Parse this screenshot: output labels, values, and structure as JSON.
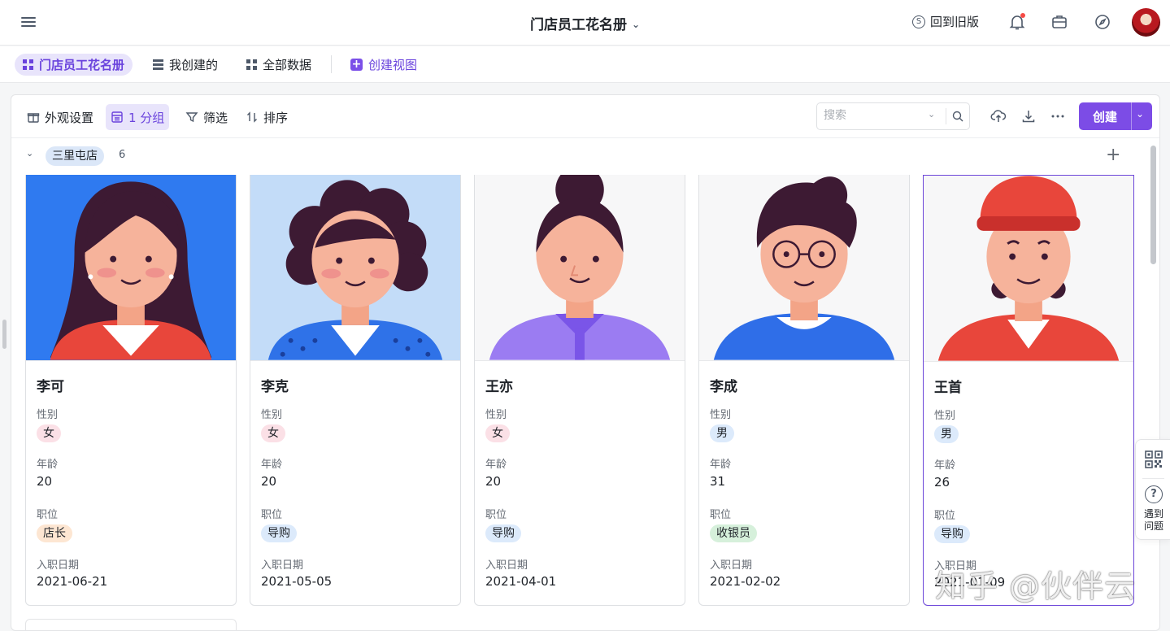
{
  "app": {
    "title": "门店员工花名册",
    "back_old_label": "回到旧版"
  },
  "header_icons": [
    "menu-icon",
    "bell-icon",
    "briefcase-icon",
    "compass-icon"
  ],
  "tabs": [
    {
      "label": "门店员工花名册",
      "active": true
    },
    {
      "label": "我创建的",
      "active": false
    },
    {
      "label": "全部数据",
      "active": false
    },
    {
      "label": "创建视图",
      "active": false
    }
  ],
  "toolbar": {
    "appearance_label": "外观设置",
    "group_label": "1 分组",
    "filter_label": "筛选",
    "sort_label": "排序",
    "search_placeholder": "搜索",
    "create_label": "创建"
  },
  "group": {
    "name": "三里屯店",
    "count": "6"
  },
  "fields": {
    "gender": "性别",
    "age": "年龄",
    "position": "职位",
    "hire_date": "入职日期"
  },
  "cards": [
    {
      "name": "李可",
      "gender": "女",
      "age": "20",
      "position": "店长",
      "hire_date": "2021-06-21"
    },
    {
      "name": "李克",
      "gender": "女",
      "age": "20",
      "position": "导购",
      "hire_date": "2021-05-05"
    },
    {
      "name": "王亦",
      "gender": "女",
      "age": "20",
      "position": "导购",
      "hire_date": "2021-04-01"
    },
    {
      "name": "李成",
      "gender": "男",
      "age": "31",
      "position": "收银员",
      "hire_date": "2021-02-02"
    },
    {
      "name": "王首",
      "gender": "男",
      "age": "26",
      "position": "导购",
      "hire_date": "2021-01-09"
    }
  ],
  "side_widget": {
    "help_label": "遇到问题"
  },
  "watermark": "知乎 @伙伴云",
  "colors": {
    "accent": "#7c4ce6",
    "tag_female": "#fbe0e6",
    "tag_male": "#dceafb",
    "tag_manager": "#fde6d2",
    "tag_guide": "#dceafb",
    "tag_cashier": "#d6f0db"
  }
}
